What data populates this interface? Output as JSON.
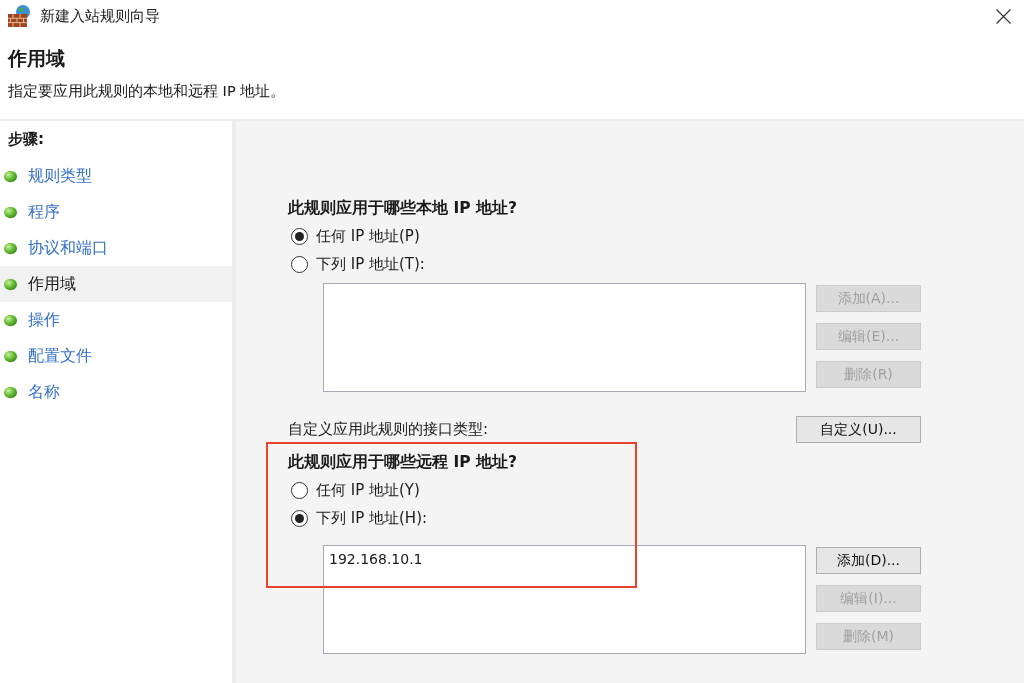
{
  "window": {
    "title": "新建入站规则向导"
  },
  "header": {
    "title": "作用域",
    "description": "指定要应用此规则的本地和远程 IP 地址。"
  },
  "steps": {
    "heading": "步骤:",
    "items": [
      {
        "label": "规则类型",
        "selected": false
      },
      {
        "label": "程序",
        "selected": false
      },
      {
        "label": "协议和端口",
        "selected": false
      },
      {
        "label": "作用域",
        "selected": true
      },
      {
        "label": "操作",
        "selected": false
      },
      {
        "label": "配置文件",
        "selected": false
      },
      {
        "label": "名称",
        "selected": false
      }
    ]
  },
  "local_addresses": {
    "question": "此规则应用于哪些本地 IP 地址?",
    "options": [
      {
        "label": "任何 IP 地址(P)",
        "selected": true
      },
      {
        "label": "下列 IP 地址(T):",
        "selected": false
      }
    ],
    "buttons": [
      {
        "label": "添加(A)...",
        "disabled": true
      },
      {
        "label": "编辑(E)...",
        "disabled": true
      },
      {
        "label": "删除(R)",
        "disabled": true
      }
    ]
  },
  "interface_types": {
    "label": "自定义应用此规则的接口类型:",
    "button": {
      "label": "自定义(U)...",
      "disabled": false
    }
  },
  "remote_addresses": {
    "highlighted": true,
    "question": "此规则应用于哪些远程 IP 地址?",
    "options": [
      {
        "label": "任何 IP 地址(Y)",
        "selected": false
      },
      {
        "label": "下列 IP 地址(H):",
        "selected": true
      }
    ],
    "addresses": [
      "192.168.10.1"
    ],
    "buttons": [
      {
        "label": "添加(D)...",
        "disabled": false
      },
      {
        "label": "编辑(I)...",
        "disabled": true
      },
      {
        "label": "删除(M)",
        "disabled": true
      }
    ]
  }
}
